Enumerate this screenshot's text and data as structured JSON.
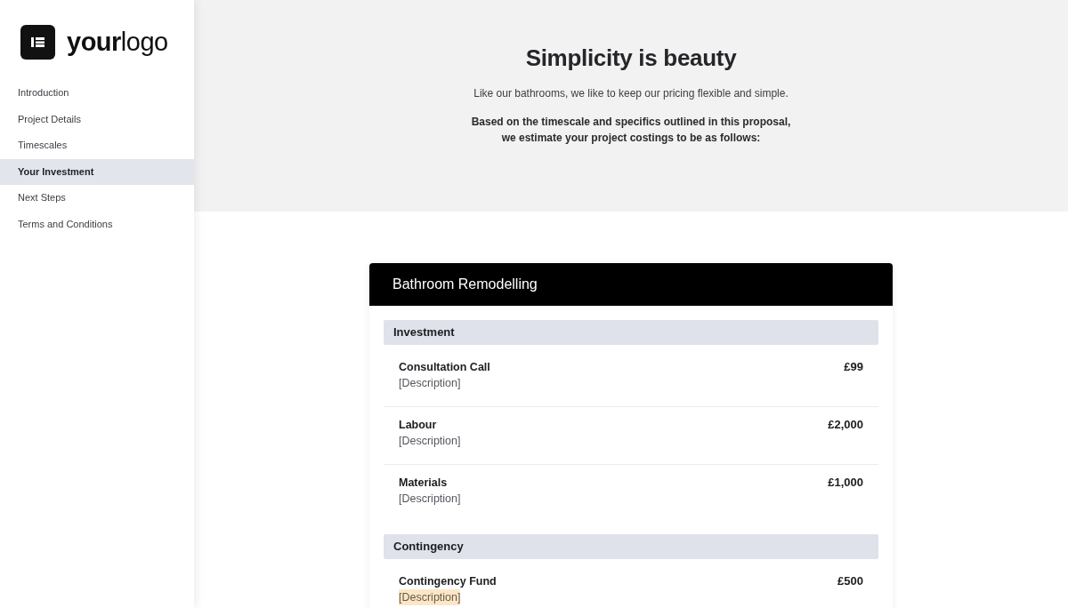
{
  "sidebar": {
    "logo": "**your**logo",
    "nav_items": [
      {
        "label": "Introduction",
        "selected": false
      },
      {
        "label": "Project Details",
        "selected": false
      },
      {
        "label": "Timescales",
        "selected": false
      },
      {
        "label": "Your Investment",
        "selected": true
      },
      {
        "label": "Next Steps",
        "selected": false
      },
      {
        "label": "Terms and Conditions",
        "selected": false
      }
    ]
  },
  "intro": {
    "title": "Simplicity is beauty",
    "subtitle": "Like our bathrooms, we like to keep our pricing flexible and simple.",
    "lead": "Based on the timescale and specifics outlined in this proposal,\nwe estimate your project costings to be as follows:"
  },
  "pricing_card": {
    "title": "Bathroom Remodelling",
    "sections": [
      {
        "heading": "Investment",
        "items": [
          {
            "name": "Consultation Call",
            "description": "[Description]",
            "price": "£99",
            "highlighted": false
          },
          {
            "name": "Labour",
            "description": "[Description]",
            "price": "£2,000",
            "highlighted": false
          },
          {
            "name": "Materials",
            "description": "[Description]",
            "price": "£1,000",
            "highlighted": false
          }
        ]
      },
      {
        "heading": "Contingency",
        "items": [
          {
            "name": "Contingency Fund",
            "description": "[Description]",
            "price": "£500",
            "highlighted": true
          }
        ]
      }
    ]
  }
}
